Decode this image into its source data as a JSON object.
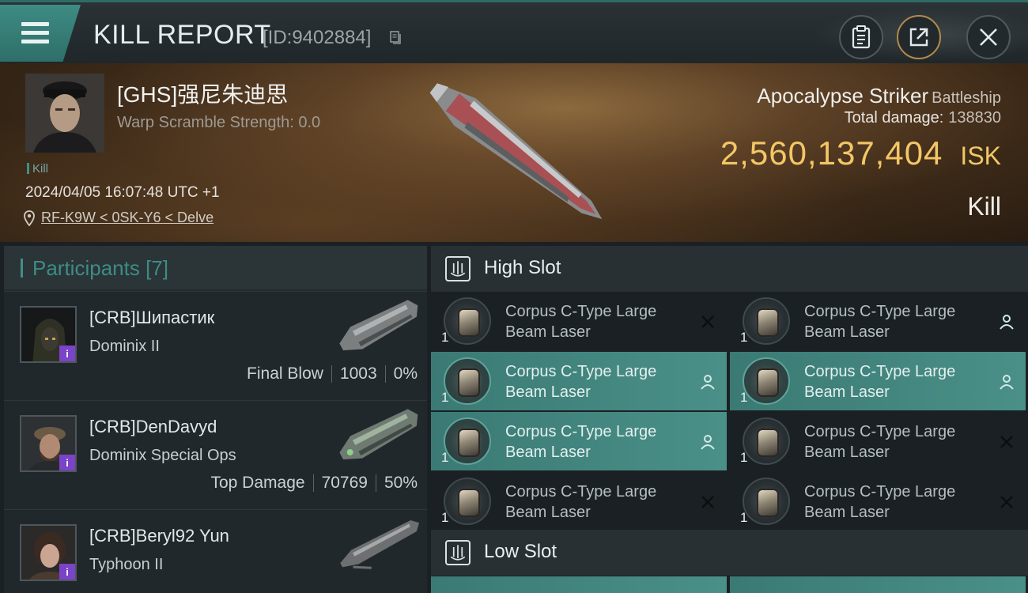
{
  "header": {
    "title": "KILL REPORT",
    "report_id": "[ID:9402884]",
    "buttons": {
      "menu": "menu-icon",
      "copy": "clipboard-icon",
      "share": "share-icon",
      "close": "close-icon"
    }
  },
  "victim": {
    "name": "[GHS]强尼朱迪思",
    "warp_scramble": "Warp Scramble Strength: 0.0",
    "kill_tag": "Kill",
    "datetime": "2024/04/05 16:07:48 UTC +1",
    "location": "RF-K9W < 0SK-Y6 < Delve"
  },
  "ship": {
    "name": "Apocalypse Striker",
    "class": "Battleship",
    "total_damage_label": "Total damage:",
    "total_damage": "138830",
    "isk_value": "2,560,137,404",
    "isk_unit": "ISK",
    "result": "Kill"
  },
  "participants": {
    "title": "Participants [7]",
    "items": [
      {
        "name": "[CRB]Шипастик",
        "ship": "Dominix II",
        "label": "Final Blow",
        "damage": "1003",
        "percent": "0%"
      },
      {
        "name": "[CRB]DenDavyd",
        "ship": "Dominix Special Ops",
        "label": "Top Damage",
        "damage": "70769",
        "percent": "50%"
      },
      {
        "name": "[CRB]Beryl92 Yun",
        "ship": "Typhoon II",
        "label": "",
        "damage": "",
        "percent": ""
      }
    ]
  },
  "slots": {
    "high": {
      "title": "High Slot",
      "modules": [
        {
          "name_line1": "Corpus C-Type Large",
          "name_line2": "Beam Laser",
          "qty": "1",
          "status": "destroyed"
        },
        {
          "name_line1": "Corpus C-Type Large",
          "name_line2": "Beam Laser",
          "qty": "1",
          "status": "dropped"
        },
        {
          "name_line1": "Corpus C-Type Large",
          "name_line2": "Beam Laser",
          "qty": "1",
          "status": "dropped"
        },
        {
          "name_line1": "Corpus C-Type Large",
          "name_line2": "Beam Laser",
          "qty": "1",
          "status": "dropped"
        },
        {
          "name_line1": "Corpus C-Type Large",
          "name_line2": "Beam Laser",
          "qty": "1",
          "status": "dropped"
        },
        {
          "name_line1": "Corpus C-Type Large",
          "name_line2": "Beam Laser",
          "qty": "1",
          "status": "destroyed"
        },
        {
          "name_line1": "Corpus C-Type Large",
          "name_line2": "Beam Laser",
          "qty": "1",
          "status": "destroyed"
        },
        {
          "name_line1": "Corpus C-Type Large",
          "name_line2": "Beam Laser",
          "qty": "1",
          "status": "destroyed"
        }
      ]
    },
    "low": {
      "title": "Low Slot"
    }
  },
  "colors": {
    "accent": "#3f8f89",
    "isk": "#f3c766",
    "faction_badge": "#7b43c8"
  }
}
